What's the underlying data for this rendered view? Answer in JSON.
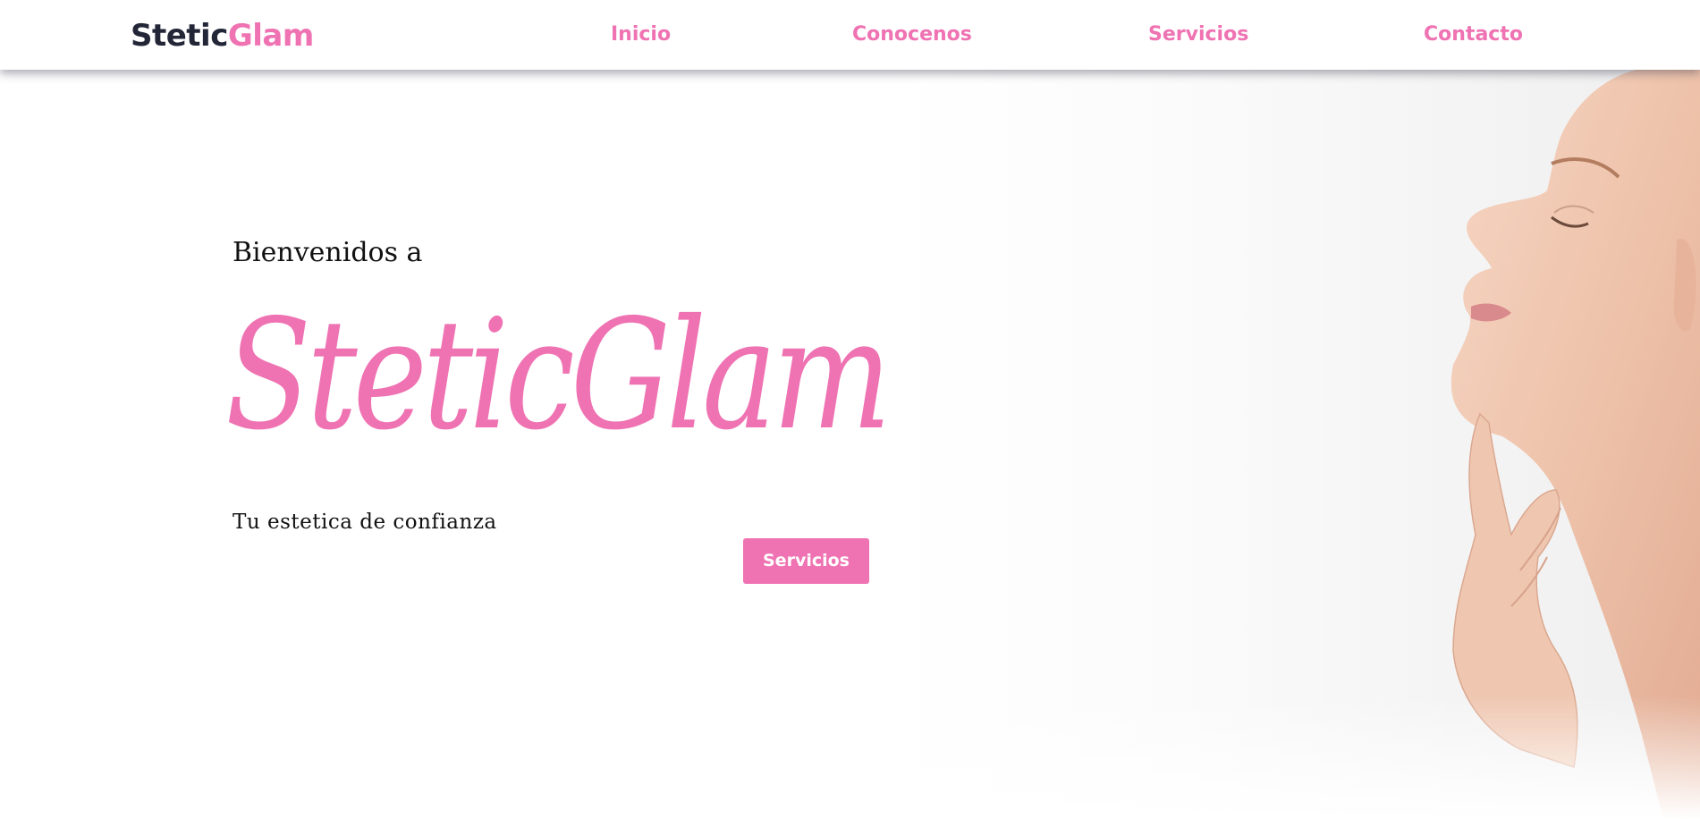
{
  "header": {
    "brand_part1": "Stetic",
    "brand_part2": "Glam",
    "nav": [
      "Inicio",
      "Conocenos",
      "Servicios",
      "Contacto"
    ]
  },
  "hero": {
    "welcome": "Bienvenidos a",
    "title_script": "SteticGlam",
    "tagline": "Tu estetica de confianza",
    "button_label": "Servicios",
    "image_icon": "woman-profile-photo"
  },
  "colors": {
    "accent": "#ef72b2",
    "brand_dark": "#222637",
    "text": "#111111",
    "background": "#ffffff"
  }
}
